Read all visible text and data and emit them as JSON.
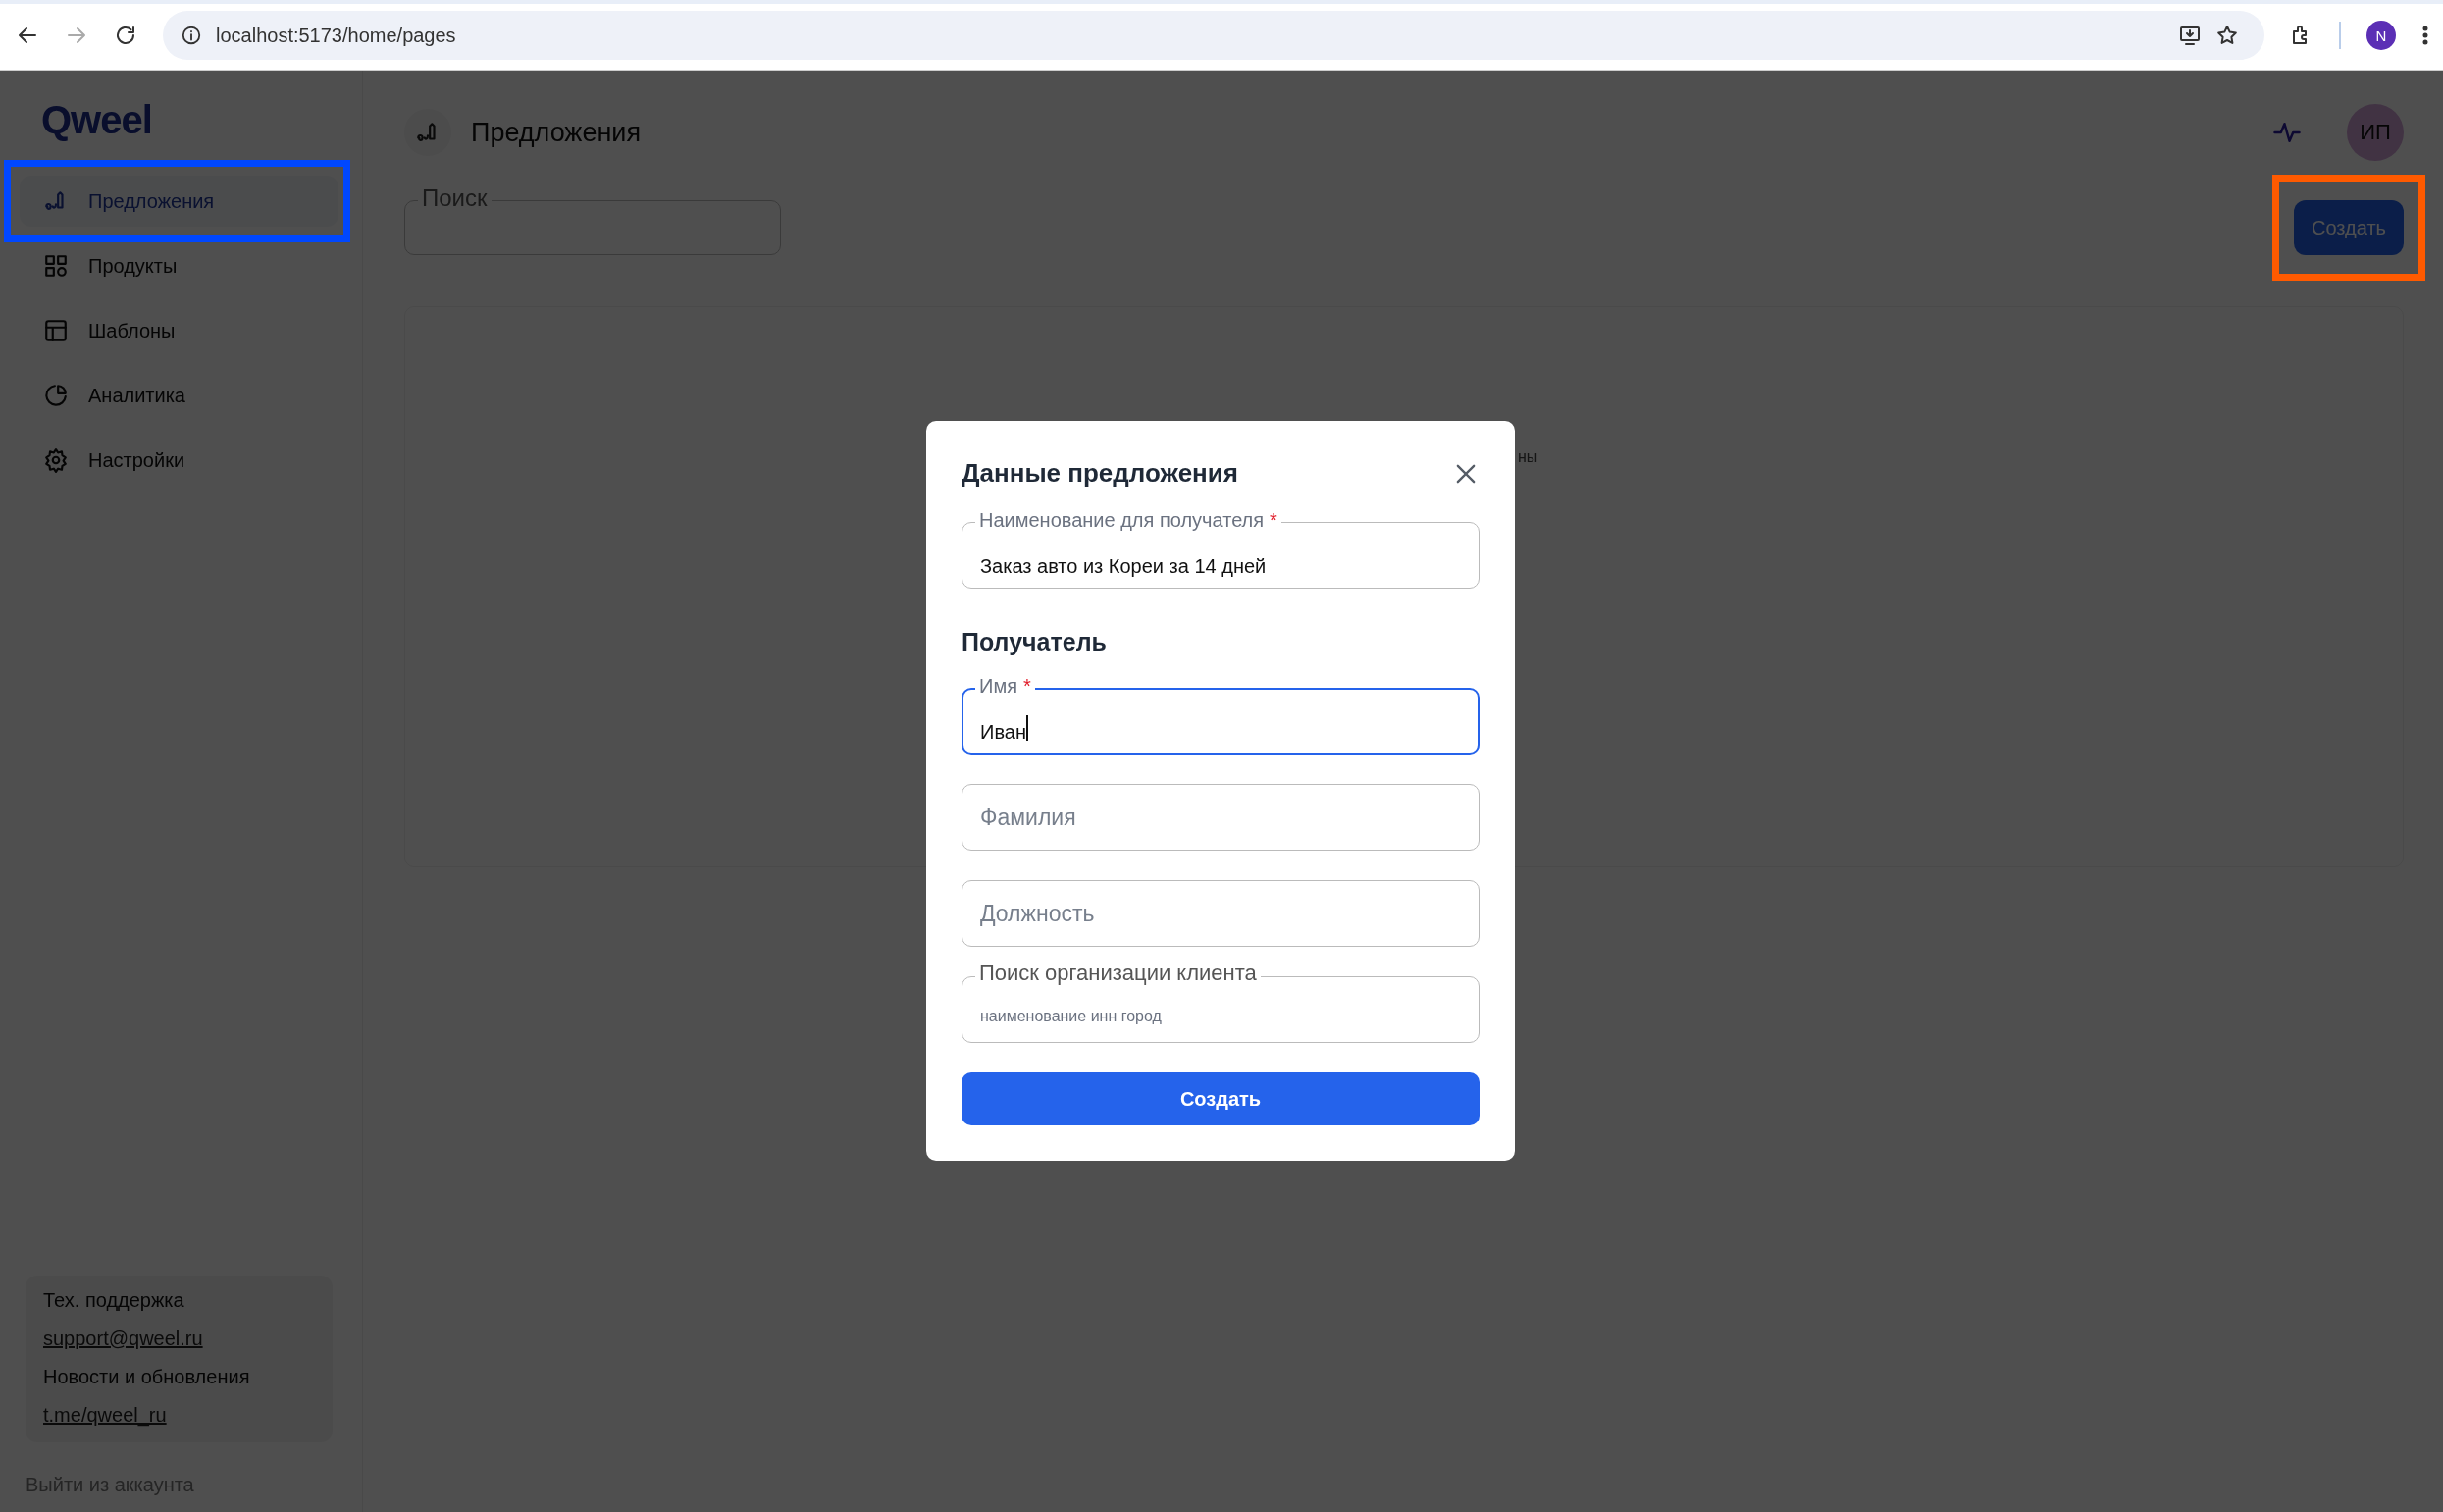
{
  "browser": {
    "url": "localhost:5173/home/pages",
    "profile_initial": "N"
  },
  "sidebar": {
    "logo": "Qweel",
    "items": [
      {
        "label": "Предложения",
        "selected": true
      },
      {
        "label": "Продукты",
        "selected": false
      },
      {
        "label": "Шаблоны",
        "selected": false
      },
      {
        "label": "Аналитика",
        "selected": false
      },
      {
        "label": "Настройки",
        "selected": false
      }
    ],
    "support": [
      {
        "kind": "text",
        "text": "Тех. поддержка"
      },
      {
        "kind": "link",
        "text": "support@qweel.ru"
      },
      {
        "kind": "text",
        "text": "Новости и обновления"
      },
      {
        "kind": "link",
        "text": "t.me/qweel_ru"
      }
    ],
    "logout": "Выйти из аккаунта"
  },
  "header": {
    "title": "Предложения",
    "avatar": "ИП"
  },
  "search": {
    "label": "Поиск"
  },
  "create_button": "Создать",
  "content_fragment": "ны",
  "modal": {
    "title": "Данные предложения",
    "sections": [
      {
        "fields": [
          {
            "label": "Наименование для получателя",
            "required_mark": "*",
            "value": "Заказ авто из Кореи за 14 дней",
            "focused": false
          }
        ]
      },
      {
        "heading": "Получатель",
        "fields": [
          {
            "label": "Имя",
            "required_mark": "*",
            "value": "Иван",
            "focused": true
          },
          {
            "placeholder": "Фамилия",
            "focused": false
          },
          {
            "placeholder": "Должность",
            "focused": false
          },
          {
            "label": "Поиск организации клиента",
            "placeholder": "наименование инн город",
            "focused": false
          }
        ]
      }
    ],
    "submit": "Создать"
  },
  "annotations": [
    {
      "kind": "selected-nav",
      "color": "#0047ff"
    },
    {
      "kind": "create-button",
      "color": "#ff5a00"
    }
  ]
}
